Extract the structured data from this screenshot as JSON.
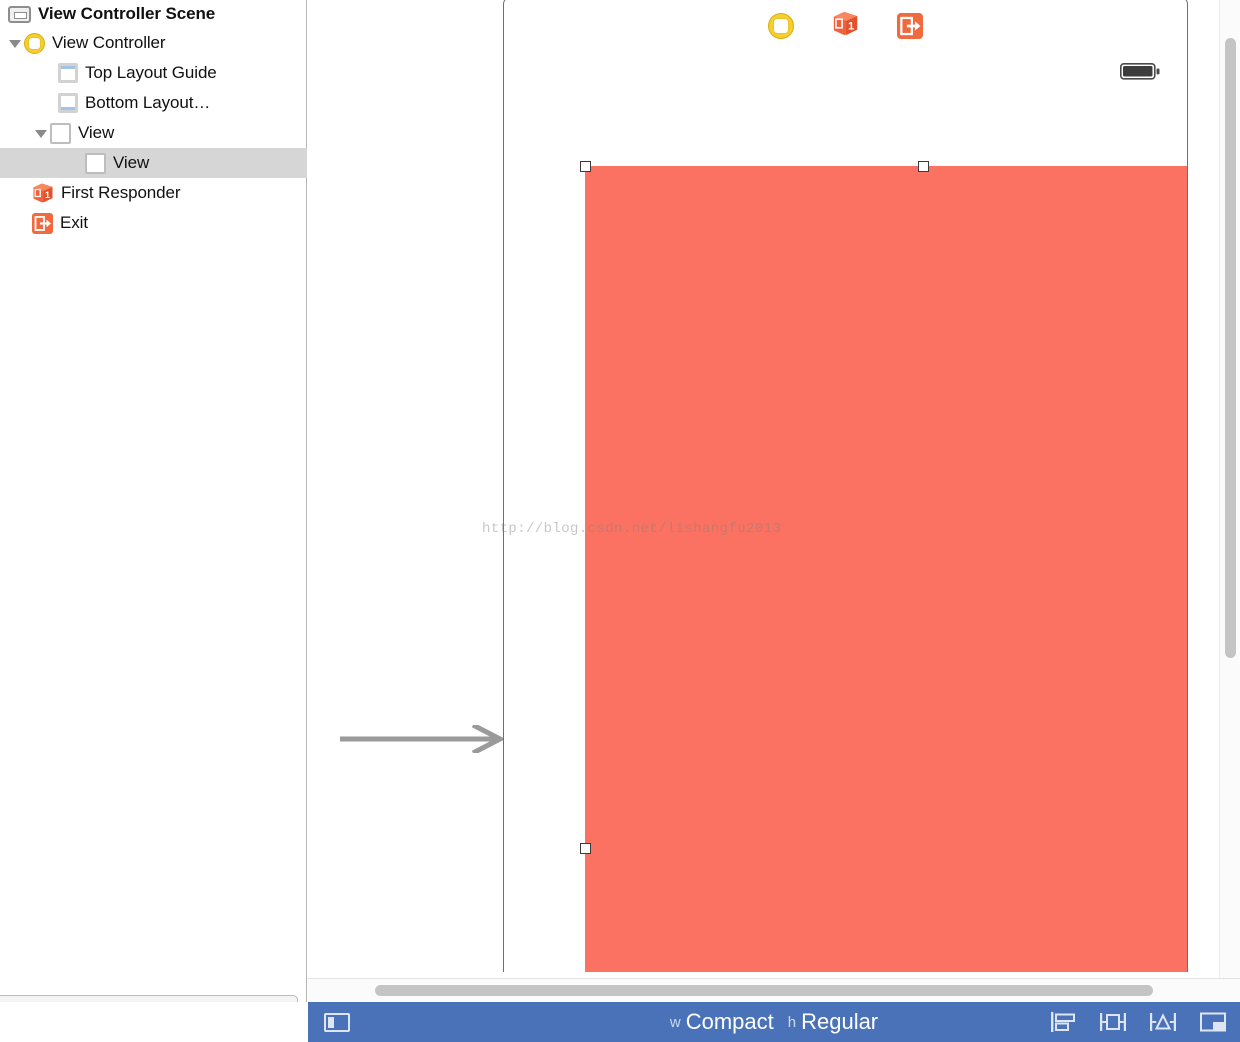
{
  "outline": {
    "scene_title": "View Controller Scene",
    "scene_icon": "scene-icon",
    "filter": {
      "value": "",
      "placeholder": "",
      "icon": "search-icon"
    },
    "items": [
      {
        "label": "View Controller",
        "icon": "view-controller-icon",
        "indent": 0,
        "disclosure": "open",
        "selected": false
      },
      {
        "label": "Top Layout Guide",
        "icon": "top-layout-guide-icon",
        "indent": 1,
        "disclosure": "none",
        "selected": false
      },
      {
        "label": "Bottom Layout…",
        "icon": "bottom-layout-guide-icon",
        "indent": 1,
        "disclosure": "none",
        "selected": false
      },
      {
        "label": "View",
        "icon": "view-icon",
        "indent": 1,
        "disclosure": "open",
        "selected": false
      },
      {
        "label": "View",
        "icon": "view-icon",
        "indent": 2,
        "disclosure": "none",
        "selected": true
      },
      {
        "label": "First Responder",
        "icon": "first-responder-icon",
        "indent": 0,
        "disclosure": "none",
        "selected": false
      },
      {
        "label": "Exit",
        "icon": "exit-icon",
        "indent": 0,
        "disclosure": "none",
        "selected": false
      }
    ]
  },
  "canvas": {
    "dock_icons": [
      {
        "name": "view-controller-dock-icon",
        "label": "View Controller"
      },
      {
        "name": "first-responder-dock-icon",
        "label": "First Responder"
      },
      {
        "name": "exit-dock-icon",
        "label": "Exit"
      }
    ],
    "entry_arrow": "initial-view-controller-arrow",
    "status_bar": {
      "battery_icon": "battery-icon"
    },
    "selected_view": {
      "name": "selected-subview",
      "fill_color": "#fc7262",
      "handles": [
        {
          "name": "handle-top-left"
        },
        {
          "name": "handle-top-center"
        },
        {
          "name": "handle-left-middle"
        }
      ]
    },
    "watermark": "http://blog.csdn.net/lishangfu2013"
  },
  "bottom_bar": {
    "background_color": "#4a72b8",
    "panel_toggle": "document-outline-toggle",
    "size_class": {
      "width_prefix": "w",
      "width_value": "Compact",
      "height_prefix": "h",
      "height_value": "Regular"
    },
    "autolayout_buttons": [
      {
        "name": "align-button",
        "label": "Align"
      },
      {
        "name": "pin-button",
        "label": "Pin"
      },
      {
        "name": "resolve-issues-button",
        "label": "Resolve Auto Layout Issues"
      },
      {
        "name": "resize-behavior-button",
        "label": "Resizing Behavior"
      }
    ]
  },
  "scrollbars": {
    "vertical": "canvas-vertical-scrollbar",
    "horizontal": "canvas-horizontal-scrollbar"
  }
}
